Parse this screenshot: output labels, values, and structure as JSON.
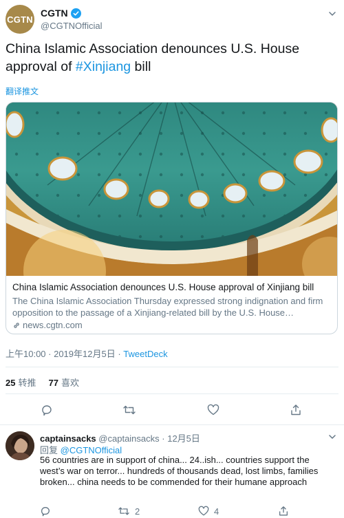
{
  "tweet": {
    "author": {
      "name": "CGTN",
      "handle": "@CGTNOfficial",
      "avatar_text": "CGTN",
      "avatar_color": "#a7894a",
      "verified": true
    },
    "text_part1": "China Islamic Association denounces U.S. House approval of ",
    "hashtag": "#Xinjiang",
    "text_part2": " bill",
    "translate_label": "翻译推文",
    "card": {
      "title": "China Islamic Association denounces U.S. House approval of Xinjiang bill",
      "description": "The China Islamic Association Thursday expressed strong indignation and firm opposition to the passage of a Xinjiang-related bill by the U.S. House…",
      "domain": "news.cgtn.com"
    },
    "timestamp": "上午10:00 · 2019年12月5日",
    "separator": " · ",
    "client": "TweetDeck",
    "stats": {
      "retweets_count": "25",
      "retweets_label": "转推",
      "likes_count": "77",
      "likes_label": "喜欢"
    }
  },
  "reply": {
    "name": "captainsacks",
    "handle": "@captainsacks",
    "date": "· 12月5日",
    "reply_prefix": "回复 ",
    "reply_to": "@CGTNOfficial",
    "text": "56 countries are in support of china... 24..ish... countries support the west’s war on terror... hundreds of thousands dead, lost limbs, families broken... china needs to be commended for their humane approach",
    "retweet_count": "2",
    "like_count": "4"
  },
  "icons": [
    "verified-badge-icon",
    "chevron-down-icon",
    "link-icon",
    "reply-icon",
    "retweet-icon",
    "like-icon",
    "share-icon"
  ],
  "colors": {
    "accent": "#1b95e0",
    "secondary_text": "#657786",
    "border": "#ccd6dd"
  }
}
